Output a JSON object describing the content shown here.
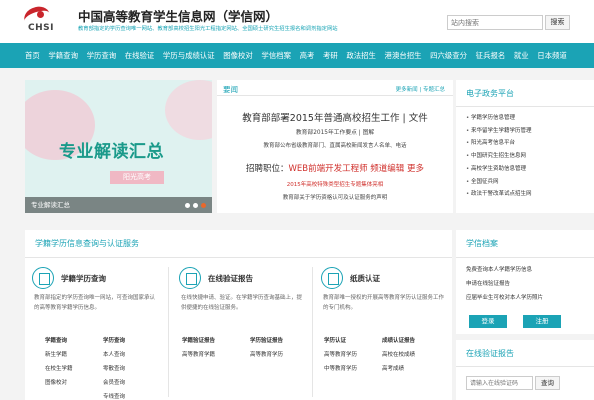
{
  "header": {
    "logo_text": "CHSI",
    "title": "中国高等教育学生信息网（学信网）",
    "subtitle": "教育部指定的学历查询唯一网站、教育部高校招生阳光工程指定网站、全国硕士研究生招生报名和调剂指定网站",
    "search_placeholder": "站内搜索",
    "search_button": "搜索"
  },
  "nav": [
    "首页",
    "学籍查询",
    "学历查询",
    "在线验证",
    "学历与成绩认证",
    "图像校对",
    "学信档案",
    "高考",
    "考研",
    "政法招生",
    "港澳台招生",
    "四六级查分",
    "征兵报名",
    "就业",
    "日本频道"
  ],
  "banner": {
    "headline": "专业解读汇总",
    "tag": "阳光高考",
    "caption": "专业解读汇总"
  },
  "news": {
    "title": "要闻",
    "more_news": "更多新闻",
    "special": "专题汇总",
    "items": [
      {
        "text": "教育部部署2015年普通高校招生工作 | 文件"
      },
      {
        "text": "教育部2015年工作要点 | 图解"
      },
      {
        "text": "教育部公布省级教育部门、直属高校新闻发言人名单、电话"
      },
      {
        "text": "招聘职位：",
        "link": "WEB前端开发工程师 频道编辑 更多"
      },
      {
        "text": "2015年高校特殊类型招生专题集体亮相"
      },
      {
        "text": "教育部关于学历资格认可及认证服务的声明"
      }
    ]
  },
  "gov": {
    "title": "电子政务平台",
    "items": [
      "学籍学历信息管理",
      "来华留学生学籍学历管理",
      "阳光高考信息平台",
      "中国研究生招生信息网",
      "高校学生资助信息管理",
      "全国征兵网",
      "政法干警改革试点招生网"
    ]
  },
  "xueli": {
    "title": "学籍学历信息查询与认证服务",
    "cols": [
      {
        "head": "学籍学历查询",
        "desc": "教育部指定的学历查询唯一网站，可查询国家承认的高等教育学籍学历信息。",
        "sub_heads": [
          "学籍查询",
          "学历查询"
        ],
        "left_links": [
          "新生学籍",
          "在校生学籍",
          "图像校对"
        ],
        "right_links": [
          "本人查询",
          "零散查询",
          "会员查询",
          "专线查询"
        ]
      },
      {
        "head": "在线验证报告",
        "desc": "在线快捷申请、验证。在学籍学历查询基础上，提供便捷的在线验证服务。",
        "sub_heads": [
          "学籍验证报告",
          "学历验证报告"
        ],
        "left_links": [
          "高等教育学籍"
        ],
        "right_links": [
          "高等教育学历"
        ]
      },
      {
        "head": "纸质认证",
        "desc": "教育部唯一授权的开展高等教育学历认证服务工作的专门机构。",
        "sub_heads": [
          "学历认证",
          "成绩认证报告"
        ],
        "left_links": [
          "高等教育学历",
          "中等教育学历"
        ],
        "right_links": [
          "高校在校成绩",
          "高考成绩"
        ]
      }
    ]
  },
  "dangan": {
    "title": "学信档案",
    "lines": [
      "免费查询本人学籍学历信息",
      "申请在线验证报告",
      "应届毕业生可校对本人学历照片"
    ],
    "login": "登录",
    "register": "注册"
  },
  "verify": {
    "title": "在线验证报告",
    "placeholder": "请输入在线验证码",
    "button": "查询"
  }
}
